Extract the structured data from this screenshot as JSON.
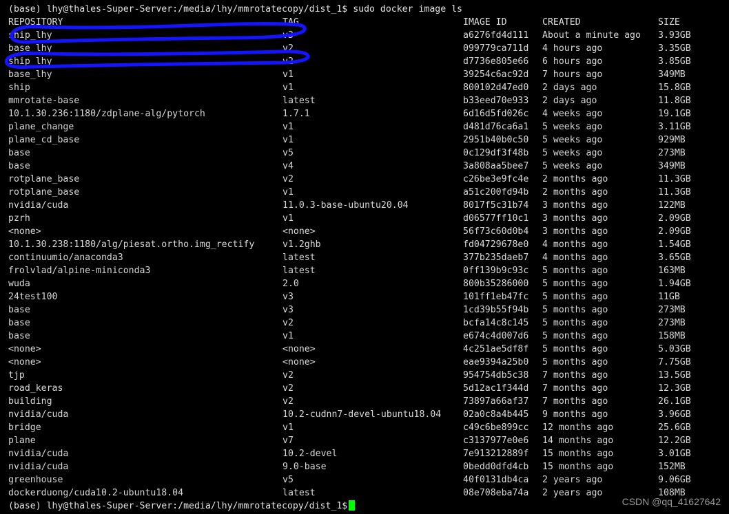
{
  "terminal": {
    "window_title": "docker image ls",
    "colors": {
      "background": "#000000",
      "foreground": "#d7d7d7",
      "cursor": "#00ff00",
      "annotation": "#1414ff"
    },
    "prompt_top": "(base) lhy@thales-Super-Server:/media/lhy/mmrotatecopy/dist_1$ sudo docker image ls",
    "prompt_bottom": "(base) lhy@thales-Super-Server:/media/lhy/mmrotatecopy/dist_1$",
    "cursor_glyph": "block-cursor"
  },
  "table": {
    "headers": {
      "repository": "REPOSITORY",
      "tag": "TAG",
      "image_id": "IMAGE ID",
      "created": "CREATED",
      "size": "SIZE"
    },
    "rows": [
      {
        "repository": "ship_lhy",
        "tag": "v3",
        "image_id": "a6276fd4d111",
        "created": "About a minute ago",
        "size": "3.93GB"
      },
      {
        "repository": "base_lhy",
        "tag": "v2",
        "image_id": "099779ca711d",
        "created": "4 hours ago",
        "size": "3.35GB"
      },
      {
        "repository": "ship_lhy",
        "tag": "v2",
        "image_id": "d7736e805e66",
        "created": "6 hours ago",
        "size": "3.85GB"
      },
      {
        "repository": "base_lhy",
        "tag": "v1",
        "image_id": "39254c6ac92d",
        "created": "7 hours ago",
        "size": "349MB"
      },
      {
        "repository": "ship",
        "tag": "v1",
        "image_id": "800102d47ed0",
        "created": "2 days ago",
        "size": "15.8GB"
      },
      {
        "repository": "mmrotate-base",
        "tag": "latest",
        "image_id": "b33eed70e933",
        "created": "2 days ago",
        "size": "11.8GB"
      },
      {
        "repository": "10.1.30.236:1180/zdplane-alg/pytorch",
        "tag": "1.7.1",
        "image_id": "6d16d5fd026c",
        "created": "4 weeks ago",
        "size": "19.1GB"
      },
      {
        "repository": "plane_change",
        "tag": "v1",
        "image_id": "d481d76ca6a1",
        "created": "5 weeks ago",
        "size": "3.11GB"
      },
      {
        "repository": "plane_cd_base",
        "tag": "v1",
        "image_id": "2951b40b0c50",
        "created": "5 weeks ago",
        "size": "929MB"
      },
      {
        "repository": "base",
        "tag": "v5",
        "image_id": "0c129df3f48b",
        "created": "5 weeks ago",
        "size": "273MB"
      },
      {
        "repository": "base",
        "tag": "v4",
        "image_id": "3a808aa5bee7",
        "created": "5 weeks ago",
        "size": "349MB"
      },
      {
        "repository": "rotplane_base",
        "tag": "v2",
        "image_id": "c26be3e9fc4e",
        "created": "2 months ago",
        "size": "11.3GB"
      },
      {
        "repository": "rotplane_base",
        "tag": "v1",
        "image_id": "a51c200fd94b",
        "created": "2 months ago",
        "size": "11.3GB"
      },
      {
        "repository": "nvidia/cuda",
        "tag": "11.0.3-base-ubuntu20.04",
        "image_id": "8017f5c31b74",
        "created": "3 months ago",
        "size": "122MB"
      },
      {
        "repository": "pzrh",
        "tag": "v1",
        "image_id": "d06577ff10c1",
        "created": "3 months ago",
        "size": "2.09GB"
      },
      {
        "repository": "<none>",
        "tag": "<none>",
        "image_id": "56f73c60d0b4",
        "created": "3 months ago",
        "size": "2.09GB"
      },
      {
        "repository": "10.1.30.238:1180/alg/piesat.ortho.img_rectify",
        "tag": "v1.2ghb",
        "image_id": "fd04729678e0",
        "created": "4 months ago",
        "size": "1.54GB"
      },
      {
        "repository": "continuumio/anaconda3",
        "tag": "latest",
        "image_id": "377b235daeb7",
        "created": "4 months ago",
        "size": "3.65GB"
      },
      {
        "repository": "frolvlad/alpine-miniconda3",
        "tag": "latest",
        "image_id": "0ff139b9c93c",
        "created": "5 months ago",
        "size": "163MB"
      },
      {
        "repository": "wuda",
        "tag": "2.0",
        "image_id": "800b35286000",
        "created": "5 months ago",
        "size": "1.94GB"
      },
      {
        "repository": "24test100",
        "tag": "v3",
        "image_id": "101ff1eb47fc",
        "created": "5 months ago",
        "size": "11GB"
      },
      {
        "repository": "base",
        "tag": "v3",
        "image_id": "1cd39b55f94b",
        "created": "5 months ago",
        "size": "273MB"
      },
      {
        "repository": "base",
        "tag": "v2",
        "image_id": "bcfa14c8c145",
        "created": "5 months ago",
        "size": "273MB"
      },
      {
        "repository": "base",
        "tag": "v1",
        "image_id": "e674c4d007d6",
        "created": "5 months ago",
        "size": "158MB"
      },
      {
        "repository": "<none>",
        "tag": "<none>",
        "image_id": "4c251ae5df8f",
        "created": "5 months ago",
        "size": "5.03GB"
      },
      {
        "repository": "<none>",
        "tag": "<none>",
        "image_id": "eae9394a25b0",
        "created": "5 months ago",
        "size": "7.75GB"
      },
      {
        "repository": "tjp",
        "tag": "v2",
        "image_id": "954754db5c38",
        "created": "7 months ago",
        "size": "13.5GB"
      },
      {
        "repository": "road_keras",
        "tag": "v2",
        "image_id": "5d12ac1f344d",
        "created": "7 months ago",
        "size": "12.3GB"
      },
      {
        "repository": "building",
        "tag": "v2",
        "image_id": "73897a66af37",
        "created": "7 months ago",
        "size": "26.1GB"
      },
      {
        "repository": "nvidia/cuda",
        "tag": "10.2-cudnn7-devel-ubuntu18.04",
        "image_id": "02a0c8a4b445",
        "created": "9 months ago",
        "size": "3.96GB"
      },
      {
        "repository": "bridge",
        "tag": "v1",
        "image_id": "c49c6be899cc",
        "created": "12 months ago",
        "size": "25.6GB"
      },
      {
        "repository": "plane",
        "tag": "v7",
        "image_id": "c3137977e0e6",
        "created": "14 months ago",
        "size": "12.2GB"
      },
      {
        "repository": "nvidia/cuda",
        "tag": "10.2-devel",
        "image_id": "7e913212889f",
        "created": "15 months ago",
        "size": "3.01GB"
      },
      {
        "repository": "nvidia/cuda",
        "tag": "9.0-base",
        "image_id": "0bedd0dfd4cb",
        "created": "15 months ago",
        "size": "152MB"
      },
      {
        "repository": "greenhouse",
        "tag": "v5",
        "image_id": "40f0131db4ca",
        "created": "2 years ago",
        "size": "9.06GB"
      },
      {
        "repository": "dockerduong/cuda10.2-ubuntu18.04",
        "tag": "latest",
        "image_id": "08e708eba74a",
        "created": "2 years ago",
        "size": "108MB"
      }
    ]
  },
  "annotations": {
    "ellipse_1_label": "highlight-ship-lhy-v3",
    "ellipse_2_label": "highlight-ship-lhy-v2"
  },
  "watermark": {
    "text": "CSDN @qq_41627642"
  }
}
